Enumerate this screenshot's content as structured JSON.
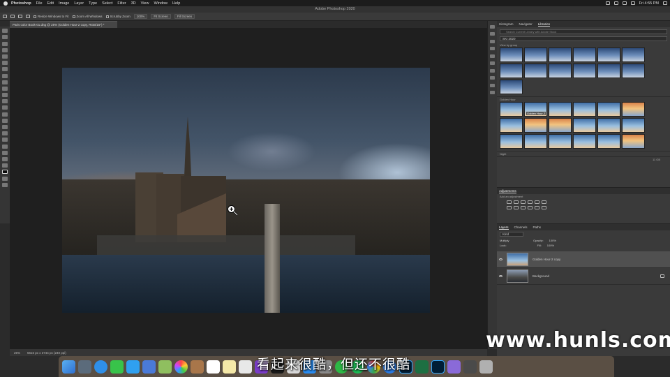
{
  "menubar": {
    "app": "Photoshop",
    "items": [
      "File",
      "Edit",
      "Image",
      "Layer",
      "Type",
      "Select",
      "Filter",
      "3D",
      "View",
      "Window",
      "Help"
    ],
    "clock": "Fri 4:55 PM"
  },
  "window": {
    "title": "Adobe Photoshop 2020"
  },
  "options_bar": {
    "resize_windows": "Resize Windows to Fit",
    "zoom_all": "Zoom All Windows",
    "scrubby": "Scrubby Zoom",
    "zoom_100": "100%",
    "fit_screen": "Fit Screen",
    "fill_screen": "Fill Screen"
  },
  "document": {
    "tab_title": "Paris color Book-01.dng @ 25% (Golden Hour-2 copy, RGB/16*) *",
    "status_zoom": "25%",
    "status_info": "5616 px x 3744 px (240 ppi)"
  },
  "libraries_panel": {
    "tabs": [
      "Histogram",
      "Navigator",
      "Libraries"
    ],
    "active_tab": "Libraries",
    "search_placeholder": "Search Current Library with Adobe Stock",
    "library_name": "SKI 2020",
    "view_by": "View by group",
    "group_golden_hour": "Golden Hour",
    "thumb_label": "Golden Hour-2",
    "group_night": "Night",
    "size_text": "11 GB"
  },
  "adjustments_panel": {
    "title": "Adjustments",
    "subtitle": "Add an adjustment"
  },
  "layers_panel": {
    "tabs": [
      "Layers",
      "Channels",
      "Paths"
    ],
    "kind": "Kind",
    "blend_mode": "Multiply",
    "opacity_label": "Opacity:",
    "opacity_value": "100%",
    "lock_label": "Lock:",
    "fill_label": "Fill:",
    "fill_value": "100%",
    "layers": [
      {
        "name": "Golden Hour-2 copy",
        "selected": true
      },
      {
        "name": "Background",
        "selected": false
      }
    ]
  },
  "overlay": {
    "subtitle": "看起来很酷，但还不很酷",
    "watermark": "www.hunls.com"
  },
  "colors": {
    "accent": "#31a8ff",
    "panel": "#3a3a3a",
    "canvas": "#1f1f1f"
  }
}
